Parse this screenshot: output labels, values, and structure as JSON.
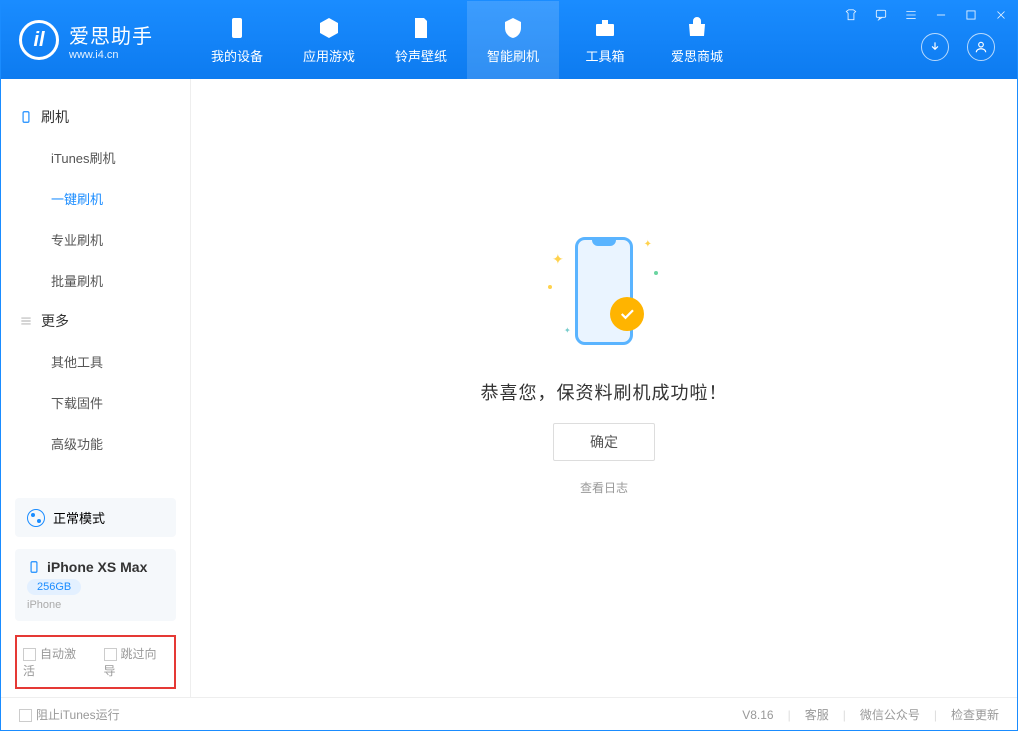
{
  "app": {
    "title": "爱思助手",
    "subtitle": "www.i4.cn"
  },
  "tabs": [
    {
      "label": "我的设备"
    },
    {
      "label": "应用游戏"
    },
    {
      "label": "铃声壁纸"
    },
    {
      "label": "智能刷机"
    },
    {
      "label": "工具箱"
    },
    {
      "label": "爱思商城"
    }
  ],
  "sidebar": {
    "group1": {
      "title": "刷机",
      "items": [
        "iTunes刷机",
        "一键刷机",
        "专业刷机",
        "批量刷机"
      ]
    },
    "group2": {
      "title": "更多",
      "items": [
        "其他工具",
        "下载固件",
        "高级功能"
      ]
    },
    "mode": "正常模式",
    "device": {
      "name": "iPhone XS Max",
      "storage": "256GB",
      "type": "iPhone"
    },
    "checks": {
      "auto_activate": "自动激活",
      "skip_guide": "跳过向导"
    }
  },
  "main": {
    "success": "恭喜您，保资料刷机成功啦！",
    "ok": "确定",
    "view_log": "查看日志"
  },
  "footer": {
    "block_itunes": "阻止iTunes运行",
    "version": "V8.16",
    "links": [
      "客服",
      "微信公众号",
      "检查更新"
    ]
  }
}
